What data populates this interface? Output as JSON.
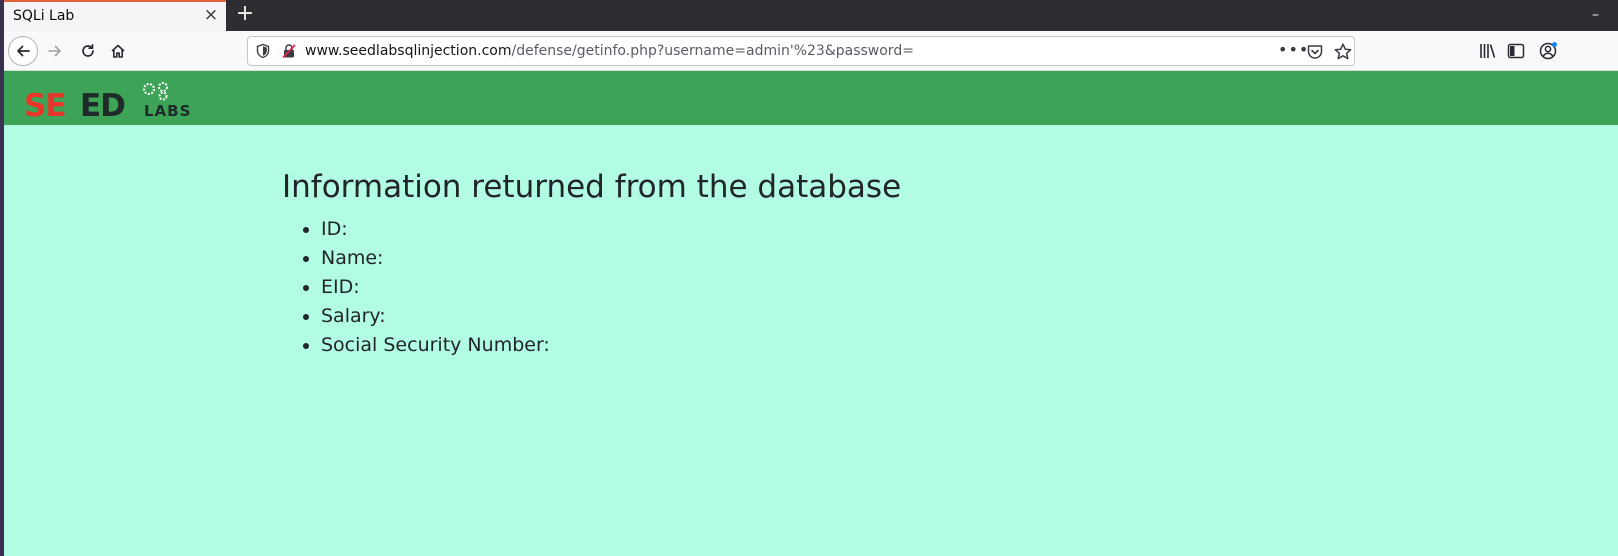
{
  "browser": {
    "tab_title": "SQLi Lab",
    "tab_close": "×",
    "new_tab": "+",
    "minimize": "–",
    "url_host": "www.seedlabsqlinjection.com",
    "url_path": "/defense/getinfo.php?username=admin'%23&password=",
    "url_more": "•••"
  },
  "site": {
    "logo_text_main": "SEED",
    "logo_text_sub": "LABS",
    "logo_colors": {
      "red": "#e8372a",
      "dark": "#1f2a2a"
    },
    "header_color": "#3da356",
    "background_color": "#b2fce4"
  },
  "main": {
    "heading": "Information returned from the database",
    "fields": [
      {
        "label": "ID:"
      },
      {
        "label": "Name:"
      },
      {
        "label": "EID:"
      },
      {
        "label": "Salary:"
      },
      {
        "label": "Social Security Number:"
      }
    ]
  }
}
